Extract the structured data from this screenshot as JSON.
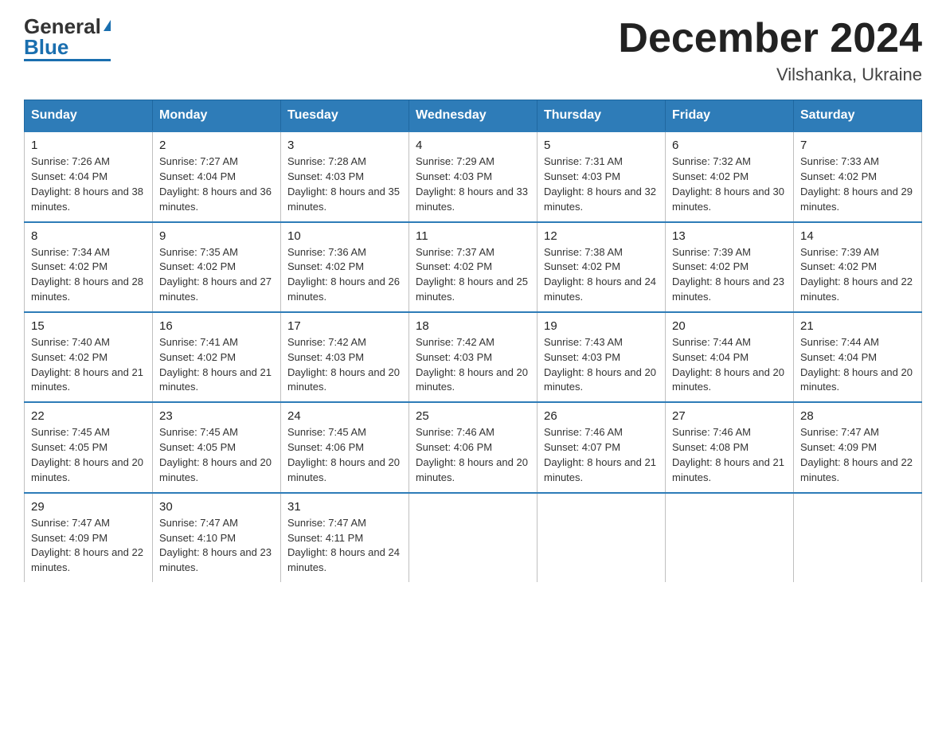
{
  "header": {
    "logo_general": "General",
    "logo_blue": "Blue",
    "month_title": "December 2024",
    "location": "Vilshanka, Ukraine"
  },
  "days_of_week": [
    "Sunday",
    "Monday",
    "Tuesday",
    "Wednesday",
    "Thursday",
    "Friday",
    "Saturday"
  ],
  "weeks": [
    [
      {
        "day": "1",
        "sunrise": "7:26 AM",
        "sunset": "4:04 PM",
        "daylight": "8 hours and 38 minutes."
      },
      {
        "day": "2",
        "sunrise": "7:27 AM",
        "sunset": "4:04 PM",
        "daylight": "8 hours and 36 minutes."
      },
      {
        "day": "3",
        "sunrise": "7:28 AM",
        "sunset": "4:03 PM",
        "daylight": "8 hours and 35 minutes."
      },
      {
        "day": "4",
        "sunrise": "7:29 AM",
        "sunset": "4:03 PM",
        "daylight": "8 hours and 33 minutes."
      },
      {
        "day": "5",
        "sunrise": "7:31 AM",
        "sunset": "4:03 PM",
        "daylight": "8 hours and 32 minutes."
      },
      {
        "day": "6",
        "sunrise": "7:32 AM",
        "sunset": "4:02 PM",
        "daylight": "8 hours and 30 minutes."
      },
      {
        "day": "7",
        "sunrise": "7:33 AM",
        "sunset": "4:02 PM",
        "daylight": "8 hours and 29 minutes."
      }
    ],
    [
      {
        "day": "8",
        "sunrise": "7:34 AM",
        "sunset": "4:02 PM",
        "daylight": "8 hours and 28 minutes."
      },
      {
        "day": "9",
        "sunrise": "7:35 AM",
        "sunset": "4:02 PM",
        "daylight": "8 hours and 27 minutes."
      },
      {
        "day": "10",
        "sunrise": "7:36 AM",
        "sunset": "4:02 PM",
        "daylight": "8 hours and 26 minutes."
      },
      {
        "day": "11",
        "sunrise": "7:37 AM",
        "sunset": "4:02 PM",
        "daylight": "8 hours and 25 minutes."
      },
      {
        "day": "12",
        "sunrise": "7:38 AM",
        "sunset": "4:02 PM",
        "daylight": "8 hours and 24 minutes."
      },
      {
        "day": "13",
        "sunrise": "7:39 AM",
        "sunset": "4:02 PM",
        "daylight": "8 hours and 23 minutes."
      },
      {
        "day": "14",
        "sunrise": "7:39 AM",
        "sunset": "4:02 PM",
        "daylight": "8 hours and 22 minutes."
      }
    ],
    [
      {
        "day": "15",
        "sunrise": "7:40 AM",
        "sunset": "4:02 PM",
        "daylight": "8 hours and 21 minutes."
      },
      {
        "day": "16",
        "sunrise": "7:41 AM",
        "sunset": "4:02 PM",
        "daylight": "8 hours and 21 minutes."
      },
      {
        "day": "17",
        "sunrise": "7:42 AM",
        "sunset": "4:03 PM",
        "daylight": "8 hours and 20 minutes."
      },
      {
        "day": "18",
        "sunrise": "7:42 AM",
        "sunset": "4:03 PM",
        "daylight": "8 hours and 20 minutes."
      },
      {
        "day": "19",
        "sunrise": "7:43 AM",
        "sunset": "4:03 PM",
        "daylight": "8 hours and 20 minutes."
      },
      {
        "day": "20",
        "sunrise": "7:44 AM",
        "sunset": "4:04 PM",
        "daylight": "8 hours and 20 minutes."
      },
      {
        "day": "21",
        "sunrise": "7:44 AM",
        "sunset": "4:04 PM",
        "daylight": "8 hours and 20 minutes."
      }
    ],
    [
      {
        "day": "22",
        "sunrise": "7:45 AM",
        "sunset": "4:05 PM",
        "daylight": "8 hours and 20 minutes."
      },
      {
        "day": "23",
        "sunrise": "7:45 AM",
        "sunset": "4:05 PM",
        "daylight": "8 hours and 20 minutes."
      },
      {
        "day": "24",
        "sunrise": "7:45 AM",
        "sunset": "4:06 PM",
        "daylight": "8 hours and 20 minutes."
      },
      {
        "day": "25",
        "sunrise": "7:46 AM",
        "sunset": "4:06 PM",
        "daylight": "8 hours and 20 minutes."
      },
      {
        "day": "26",
        "sunrise": "7:46 AM",
        "sunset": "4:07 PM",
        "daylight": "8 hours and 21 minutes."
      },
      {
        "day": "27",
        "sunrise": "7:46 AM",
        "sunset": "4:08 PM",
        "daylight": "8 hours and 21 minutes."
      },
      {
        "day": "28",
        "sunrise": "7:47 AM",
        "sunset": "4:09 PM",
        "daylight": "8 hours and 22 minutes."
      }
    ],
    [
      {
        "day": "29",
        "sunrise": "7:47 AM",
        "sunset": "4:09 PM",
        "daylight": "8 hours and 22 minutes."
      },
      {
        "day": "30",
        "sunrise": "7:47 AM",
        "sunset": "4:10 PM",
        "daylight": "8 hours and 23 minutes."
      },
      {
        "day": "31",
        "sunrise": "7:47 AM",
        "sunset": "4:11 PM",
        "daylight": "8 hours and 24 minutes."
      },
      null,
      null,
      null,
      null
    ]
  ]
}
